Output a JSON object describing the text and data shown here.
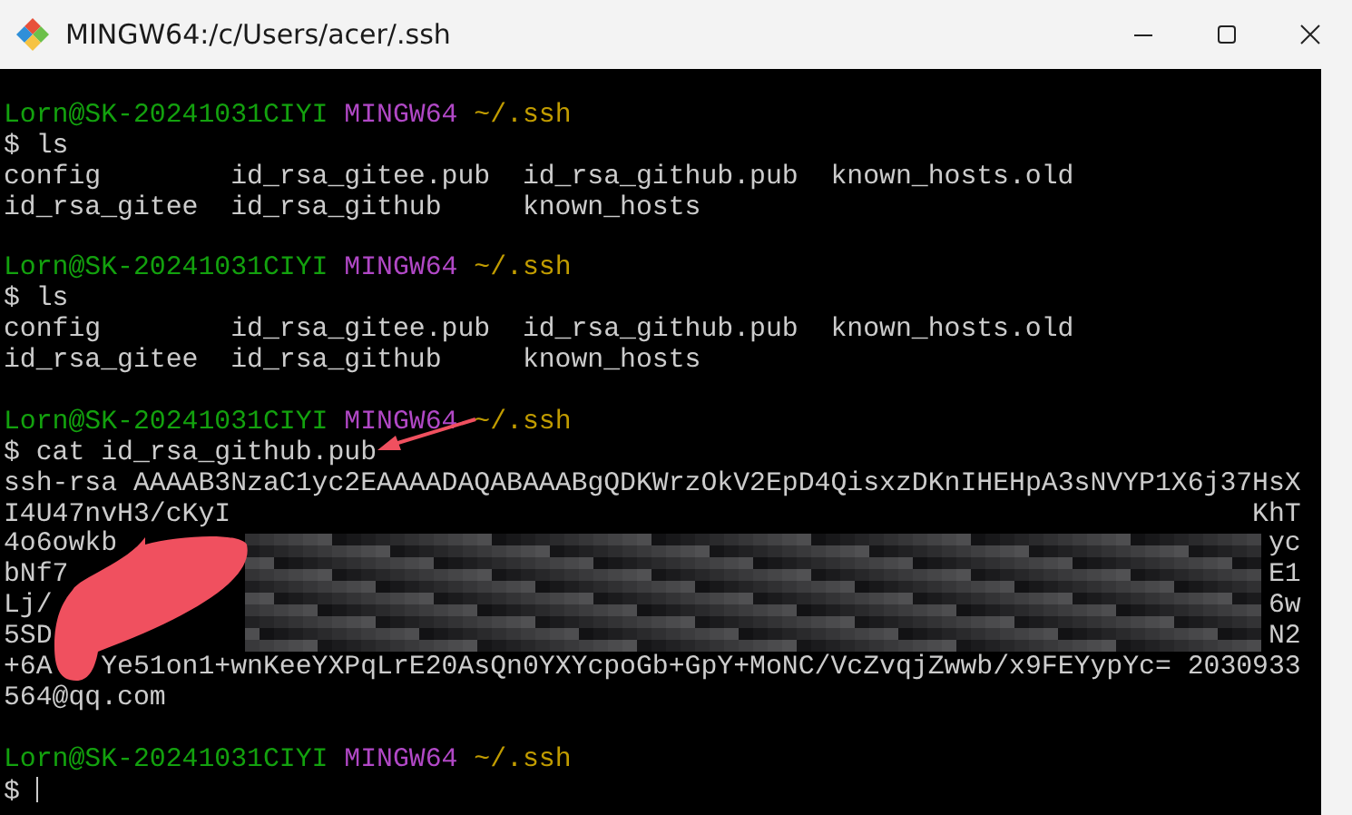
{
  "window": {
    "title": "MINGW64:/c/Users/acer/.ssh"
  },
  "terminal": {
    "lines": [
      {
        "kind": "prompt",
        "user": "Lorn@SK-20241031CIYI",
        "system": "MINGW64",
        "path": "~/.ssh"
      },
      {
        "kind": "command",
        "prompt": "$",
        "text": "ls"
      },
      {
        "kind": "columns",
        "cells": [
          "config",
          "id_rsa_gitee.pub",
          "id_rsa_github.pub",
          "known_hosts.old"
        ]
      },
      {
        "kind": "columns",
        "cells": [
          "id_rsa_gitee",
          "id_rsa_github",
          "known_hosts"
        ]
      },
      {
        "kind": "blank"
      },
      {
        "kind": "prompt",
        "user": "Lorn@SK-20241031CIYI",
        "system": "MINGW64",
        "path": "~/.ssh"
      },
      {
        "kind": "command",
        "prompt": "$",
        "text": "ls"
      },
      {
        "kind": "columns",
        "cells": [
          "config",
          "id_rsa_gitee.pub",
          "id_rsa_github.pub",
          "known_hosts.old"
        ]
      },
      {
        "kind": "columns",
        "cells": [
          "id_rsa_gitee",
          "id_rsa_github",
          "known_hosts"
        ]
      },
      {
        "kind": "blank"
      },
      {
        "kind": "prompt",
        "user": "Lorn@SK-20241031CIYI",
        "system": "MINGW64",
        "path": "~/.ssh"
      },
      {
        "kind": "command",
        "prompt": "$",
        "text": "cat id_rsa_github.pub"
      },
      {
        "kind": "output",
        "text": "ssh-rsa AAAAB3NzaC1yc2EAAAADAQABAAABgQDKWrzOkV2EpD4QisxzDKnIHEHpA3sNVYP1X6j37HsX"
      },
      {
        "kind": "partial",
        "head": "I4U47nvH3/cKyI",
        "tail": "KhT"
      },
      {
        "kind": "partial",
        "head": "4o6owkb",
        "tail": "yc"
      },
      {
        "kind": "partial",
        "head": "bNf7",
        "tail": "E1"
      },
      {
        "kind": "partial",
        "head": "Lj/",
        "tail": "6w"
      },
      {
        "kind": "partial",
        "head": "5SD",
        "tail": "N2"
      },
      {
        "kind": "output",
        "text": "+6A   Ye51on1+wnKeeYXPqLrE20AsQn0YXYcpoGb+GpY+MoNC/VcZvqjZwwb/x9FEYypYc= 2030933"
      },
      {
        "kind": "output",
        "text": "564@qq.com"
      },
      {
        "kind": "blank"
      },
      {
        "kind": "prompt",
        "user": "Lorn@SK-20241031CIYI",
        "system": "MINGW64",
        "path": "~/.ssh"
      },
      {
        "kind": "cursor",
        "prompt": "$"
      }
    ]
  }
}
